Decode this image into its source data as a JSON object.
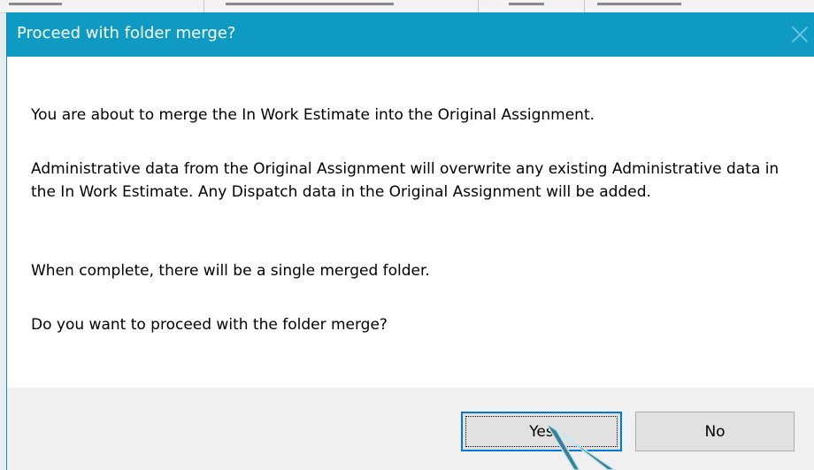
{
  "dialog": {
    "title": "Proceed with folder merge?",
    "close_icon": "close-icon",
    "messages": [
      "You are about to merge the In Work Estimate into the Original Assignment.",
      "Administrative data from the Original Assignment will overwrite any existing Administrative data in the In Work Estimate. Any Dispatch data in the Original Assignment will be added.",
      "When complete, there will be a single merged folder.",
      "Do you want to proceed with the folder merge?"
    ],
    "buttons": {
      "yes_label": "Yes",
      "no_label": "No"
    }
  },
  "colors": {
    "titlebar": "#0e9ac3",
    "title_text": "#ffffff",
    "content_bg": "#ffffff",
    "footer_bg": "#f0f0f0",
    "focus_border": "#0078d7"
  }
}
